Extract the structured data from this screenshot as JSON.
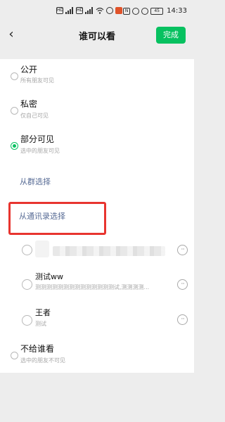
{
  "status_bar": {
    "time": "14:33",
    "battery": "45",
    "left_icons": [
      "hd-icon",
      "signal-bars-icon",
      "hd-icon",
      "signal-bars-icon",
      "wifi-icon",
      "app-notification-icon"
    ],
    "right_icons": [
      "nfc-icon",
      "vibrate-icon",
      "alarm-icon",
      "battery-icon"
    ]
  },
  "header": {
    "title": "谁可以看",
    "done_label": "完成"
  },
  "options": {
    "public": {
      "title": "公开",
      "desc": "所有朋友可见"
    },
    "private": {
      "title": "私密",
      "desc": "仅自己可见"
    },
    "partial": {
      "title": "部分可见",
      "desc": "选中的朋友可见"
    },
    "exclude": {
      "title": "不给谁看",
      "desc": "选中的朋友不可见"
    }
  },
  "links": {
    "from_group": "从群选择",
    "from_contacts": "从通讯录选择"
  },
  "members": [
    {
      "name": "",
      "desc": "",
      "blurred": true
    },
    {
      "name": "测试ww",
      "desc": "测测测测测测测测测测测测测测试,测测测测...",
      "blurred": false
    },
    {
      "name": "王者",
      "desc": "测试",
      "blurred": false
    }
  ],
  "colors": {
    "accent_green": "#07c160",
    "link_blue": "#576b95",
    "highlight_red": "#e8342f",
    "background": "#ededed"
  }
}
